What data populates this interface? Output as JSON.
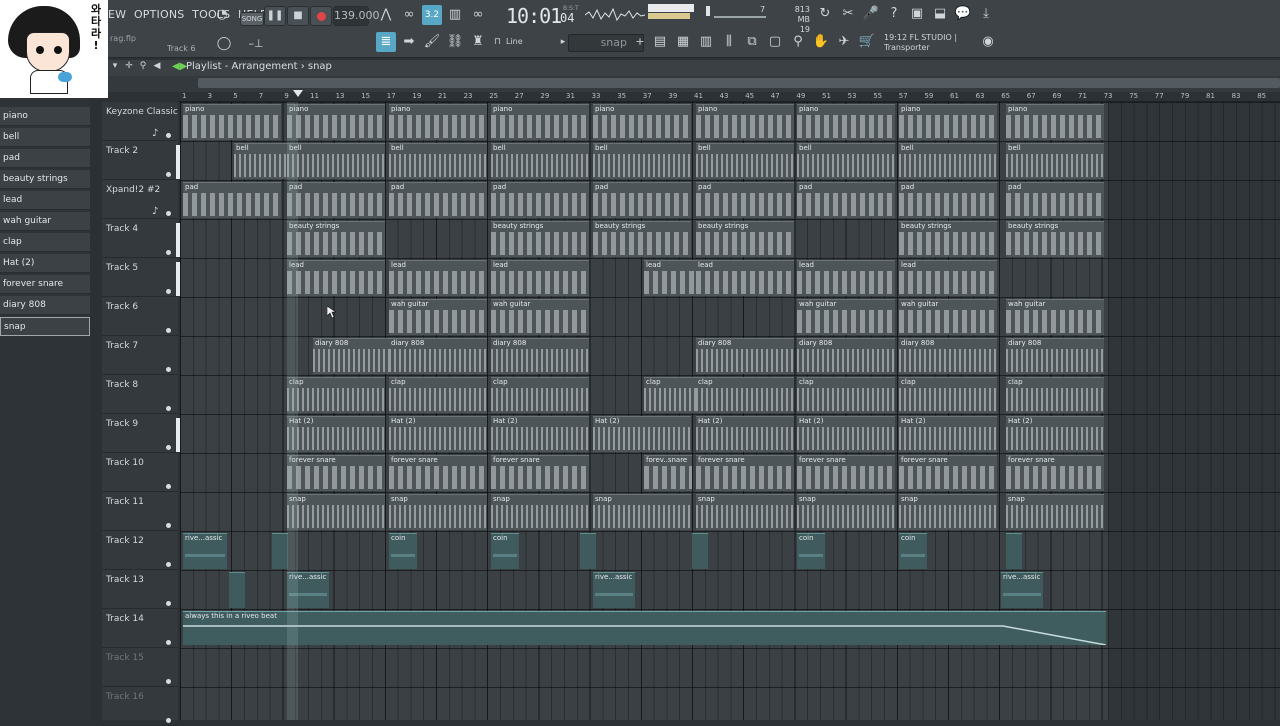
{
  "colors": {
    "toolbar": "#3d4347",
    "clip": "#4e5559",
    "audio_clip": "#3f5b5d",
    "record": "#e0454a",
    "play_green": "#6fcf54"
  },
  "menu": [
    "EW",
    "OPTIONS",
    "TOOLS",
    "HELP"
  ],
  "avatar": {
    "text": "와 타 라 !"
  },
  "toolbar": {
    "song_label": "SONG",
    "tempo": "139.000",
    "clock": "10:01",
    "clock_sub": "04",
    "clock_unit": "B:S:T",
    "mem_mb": "813 MB",
    "mem_num": "19",
    "cpu_val": "7",
    "file_name": "rag.flp",
    "track_label": "Track 6",
    "snap_mode": "Line",
    "pattern": "snap",
    "hint_line1": "19:12  FL STUDIO |",
    "hint_line2": "Transporter"
  },
  "playlist": {
    "title": "Playlist - Arrangement",
    "pattern": "snap",
    "ruler": [
      "1",
      "3",
      "5",
      "7",
      "9",
      "11",
      "13",
      "15",
      "17",
      "19",
      "21",
      "23",
      "25",
      "27",
      "29",
      "31",
      "33",
      "35",
      "37",
      "39",
      "41",
      "43",
      "45",
      "47",
      "49",
      "51",
      "53",
      "55",
      "57",
      "59",
      "61",
      "63",
      "65",
      "67",
      "69",
      "71",
      "73",
      "75",
      "77",
      "79",
      "81",
      "83",
      "85"
    ]
  },
  "picker": [
    "piano",
    "bell",
    "pad",
    "beauty strings",
    "lead",
    "wah guitar",
    "clap",
    "Hat (2)",
    "forever snare",
    "diary 808",
    "snap"
  ],
  "tracks": [
    "Keyzone Classic",
    "Track 2",
    "Xpand!2 #2",
    "Track 4",
    "Track 5",
    "Track 6",
    "Track 7",
    "Track 8",
    "Track 9",
    "Track 10",
    "Track 11",
    "Track 12",
    "Track 13",
    "Track 14",
    "Track 15",
    "Track 16"
  ],
  "clips": [
    {
      "t": 0,
      "l": "piano"
    },
    {
      "t": 1,
      "l": "bell"
    },
    {
      "t": 2,
      "l": "pad"
    },
    {
      "t": 3,
      "l": "beauty strings"
    },
    {
      "t": 4,
      "l": "lead"
    },
    {
      "t": 5,
      "l": "wah guitar"
    },
    {
      "t": 6,
      "l": "diary 808"
    },
    {
      "t": 7,
      "l": "clap"
    },
    {
      "t": 8,
      "l": "Hat (2)"
    },
    {
      "t": 9,
      "l": "forever snare"
    },
    {
      "t": 9,
      "l": "forev..snare"
    },
    {
      "t": 10,
      "l": "snap"
    },
    {
      "t": 11,
      "l": "rive...assic"
    },
    {
      "t": 11,
      "l": "coin"
    },
    {
      "t": 12,
      "l": "rive...assic"
    },
    {
      "t": 13,
      "l": "always this in a riveo beat"
    }
  ]
}
